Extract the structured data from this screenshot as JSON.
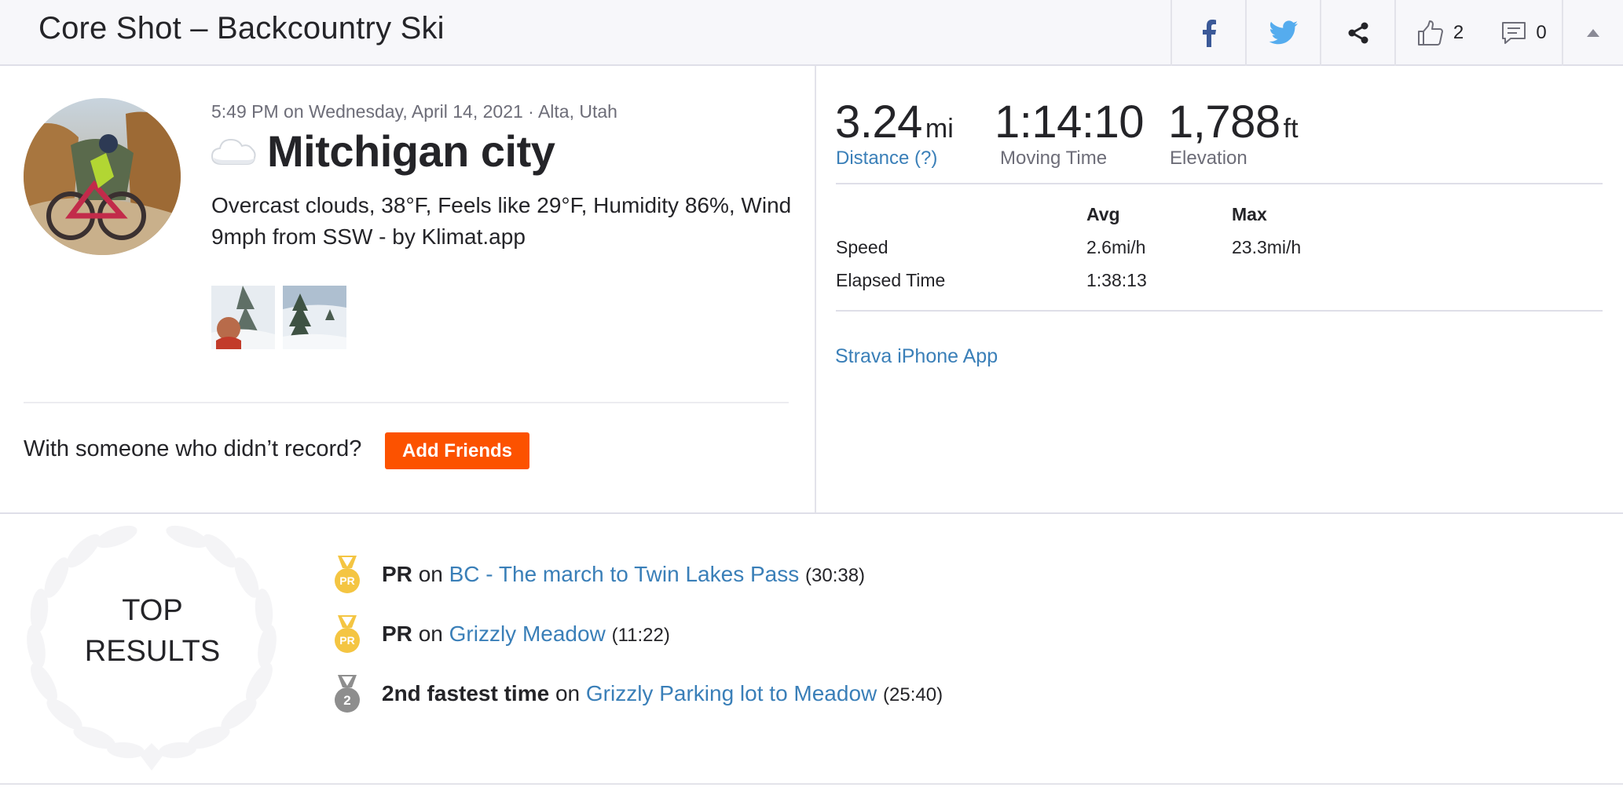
{
  "header": {
    "title": "Core Shot – Backcountry Ski",
    "kudos_count": "2",
    "comments_count": "0"
  },
  "activity": {
    "meta": "5:49 PM on Wednesday, April 14, 2021 · Alta, Utah",
    "title": "Mitchigan city",
    "description": "Overcast clouds, 38°F, Feels like 29°F, Humidity 86%, Wind 9mph from SSW - by Klimat.app",
    "weather_icon": "cloud-icon"
  },
  "friends": {
    "prompt": "With someone who didn’t record?",
    "button_label": "Add Friends"
  },
  "stats": {
    "distance": {
      "value": "3.24",
      "unit": "mi",
      "label": "Distance (?)"
    },
    "moving_time": {
      "value": "1:14:10",
      "label": "Moving Time"
    },
    "elevation": {
      "value": "1,788",
      "unit": "ft",
      "label": "Elevation"
    }
  },
  "details": {
    "headers": {
      "avg": "Avg",
      "max": "Max"
    },
    "rows": [
      {
        "label": "Speed",
        "avg": "2.6mi/h",
        "max": "23.3mi/h"
      },
      {
        "label": "Elapsed Time",
        "avg": "1:38:13",
        "max": ""
      }
    ]
  },
  "device": "Strava iPhone App",
  "top_results": {
    "heading_line1": "TOP",
    "heading_line2": "RESULTS",
    "items": [
      {
        "badge": "PR",
        "label": "PR",
        "on": "on",
        "segment": "BC - The march to Twin Lakes Pass",
        "time": "(30:38)"
      },
      {
        "badge": "PR",
        "label": "PR",
        "on": "on",
        "segment": "Grizzly Meadow",
        "time": "(11:22)"
      },
      {
        "badge": "2",
        "label": "2nd fastest time",
        "on": "on",
        "segment": "Grizzly Parking lot to Meadow",
        "time": "(25:40)"
      }
    ]
  },
  "colors": {
    "brand_orange": "#fc5200",
    "link_blue": "#3a7fb8",
    "facebook_blue": "#3b5998",
    "twitter_blue": "#55acee",
    "gold_medal": "#f4c542",
    "silver_medal": "#8e8e8e"
  }
}
